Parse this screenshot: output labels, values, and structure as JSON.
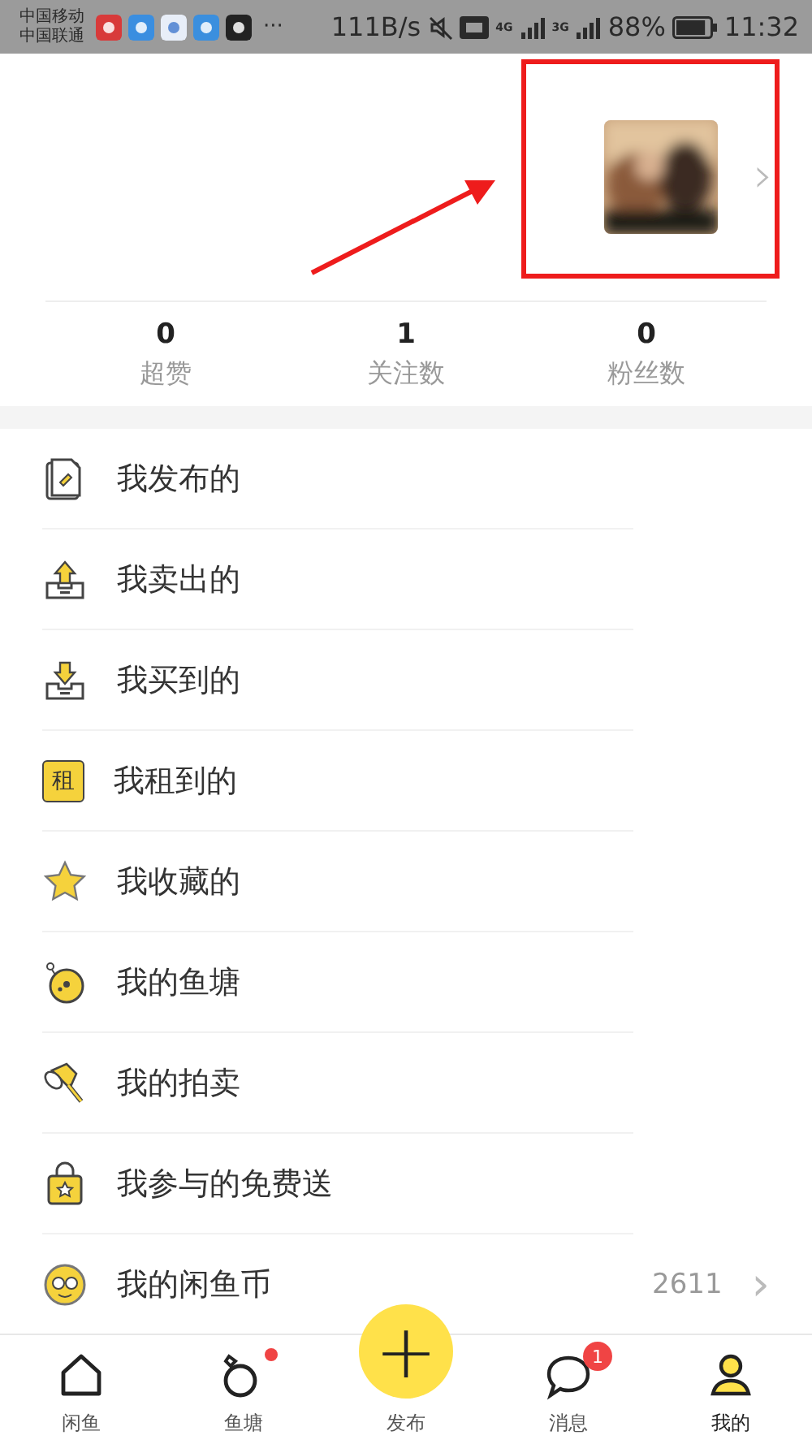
{
  "status_bar": {
    "carriers": [
      "中国移动",
      "中国联通"
    ],
    "more": "···",
    "speed": "111B/s",
    "networks": [
      "4G",
      "3G"
    ],
    "battery": "88%",
    "time": "11:32"
  },
  "profile": {
    "chevron": "›"
  },
  "stats": [
    {
      "value": "0",
      "label": "超赞"
    },
    {
      "value": "1",
      "label": "关注数"
    },
    {
      "value": "0",
      "label": "粉丝数"
    }
  ],
  "menu": [
    {
      "label": "我发布的"
    },
    {
      "label": "我卖出的"
    },
    {
      "label": "我买到的"
    },
    {
      "label": "我租到的",
      "icon_text": "租"
    },
    {
      "label": "我收藏的"
    },
    {
      "label": "我的鱼塘"
    },
    {
      "label": "我的拍卖"
    },
    {
      "label": "我参与的免费送"
    },
    {
      "label": "我的闲鱼币",
      "value": "2611",
      "chevron": "›"
    }
  ],
  "tab_bar": [
    {
      "label": "闲鱼",
      "selected": false
    },
    {
      "label": "鱼塘",
      "selected": false,
      "dot": true
    },
    {
      "label": "发布",
      "selected": false,
      "kind": "publish",
      "symbol": "+"
    },
    {
      "label": "消息",
      "selected": false,
      "badge": "1"
    },
    {
      "label": "我的",
      "selected": true
    }
  ]
}
